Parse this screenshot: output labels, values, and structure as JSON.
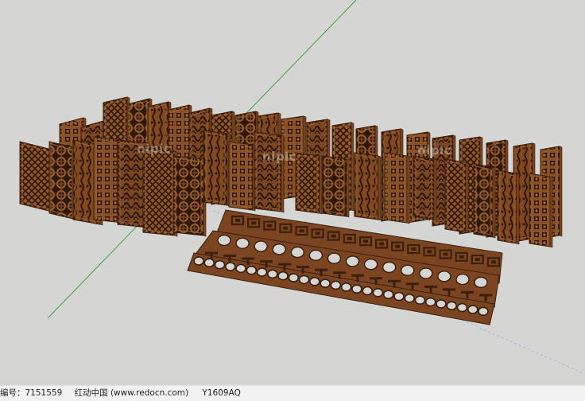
{
  "colors": {
    "background": "#d5d5d3",
    "wood_light": "#9c6235",
    "wood_mid": "#7a4520",
    "wood_dark": "#3b1f0c",
    "axis_green": "#3fa23f",
    "axis_blue": "#6a8fc8",
    "footer_bg": "#f2f2f2"
  },
  "model": {
    "panel_count": 34,
    "border_strip_count": 3,
    "border_motifs": [
      "key-fret",
      "circle-band",
      "T-fret",
      "ring-chain"
    ]
  },
  "watermarks": [
    "nipic",
    "nipic",
    "nipic"
  ],
  "footer": {
    "id_label": "编号：7151559",
    "site_label": "红动中国 (www.redocn.com)",
    "code_label": "Y1609AQ"
  }
}
